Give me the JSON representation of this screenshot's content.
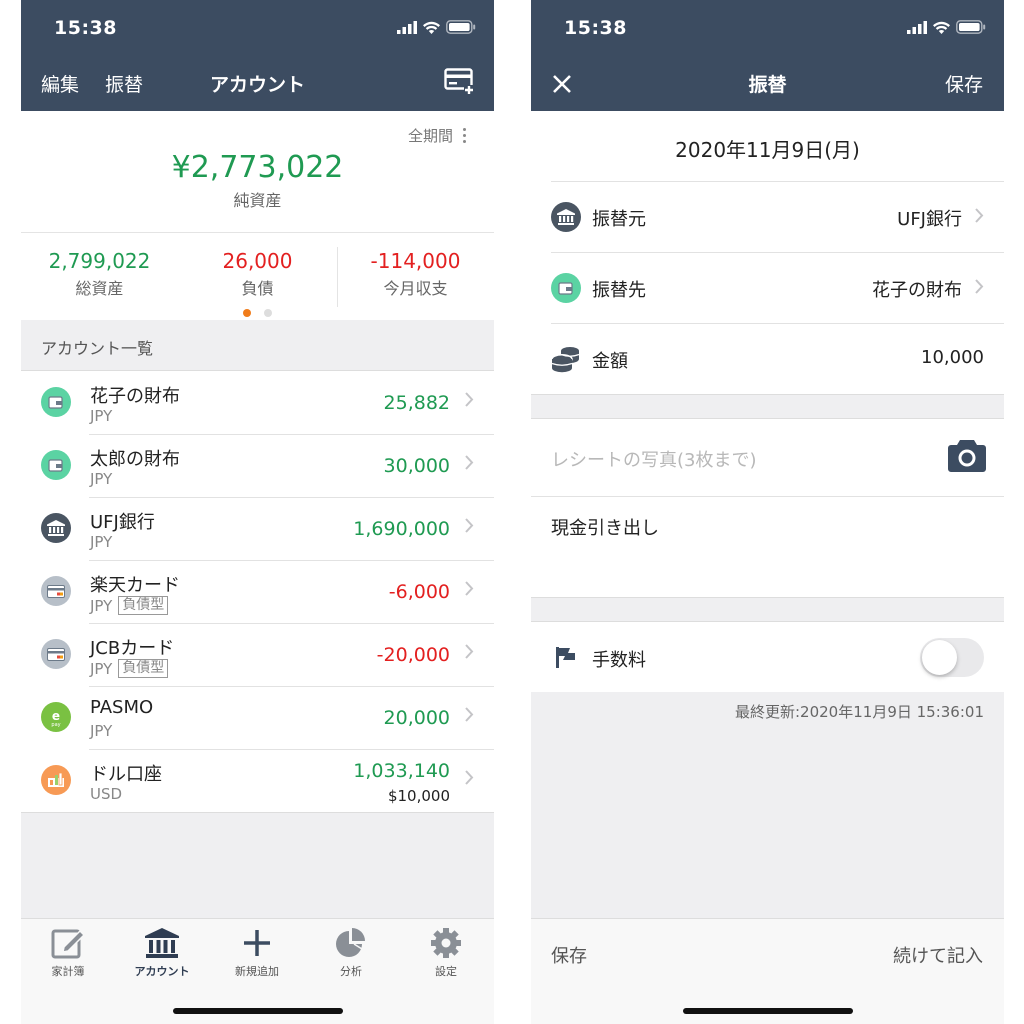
{
  "left": {
    "status": {
      "time": "15:38"
    },
    "nav": {
      "edit": "編集",
      "transfer": "振替",
      "title": "アカウント",
      "add_icon": "card-add-icon"
    },
    "summary": {
      "period": "全期間",
      "net_worth": "¥2,773,022",
      "net_worth_label": "純資産",
      "stats": [
        {
          "value": "2,799,022",
          "label": "総資産",
          "color": "#1f9a52"
        },
        {
          "value": "26,000",
          "label": "負債",
          "color": "#e32020"
        },
        {
          "value": "-114,000",
          "label": "今月収支",
          "color": "#e32020"
        }
      ],
      "page_index": 1,
      "page_count": 2
    },
    "section_title": "アカウント一覧",
    "accounts": [
      {
        "name": "花子の財布",
        "currency": "JPY",
        "amount": "25,882",
        "color": "green",
        "icon": "wallet-icon",
        "icon_bg": "#5bd3a3"
      },
      {
        "name": "太郎の財布",
        "currency": "JPY",
        "amount": "30,000",
        "color": "green",
        "icon": "wallet-icon",
        "icon_bg": "#5bd3a3"
      },
      {
        "name": "UFJ銀行",
        "currency": "JPY",
        "amount": "1,690,000",
        "color": "green",
        "icon": "bank-icon",
        "icon_bg": "#4a5562"
      },
      {
        "name": "楽天カード",
        "currency": "JPY",
        "tag": "負債型",
        "amount": "-6,000",
        "color": "red",
        "icon": "credit-card-icon",
        "icon_bg": "#b7bfc8"
      },
      {
        "name": "JCBカード",
        "currency": "JPY",
        "tag": "負債型",
        "amount": "-20,000",
        "color": "red",
        "icon": "credit-card-icon",
        "icon_bg": "#b7bfc8"
      },
      {
        "name": "PASMO",
        "currency": "JPY",
        "amount": "20,000",
        "color": "green",
        "icon": "e-money-icon",
        "icon_bg": "#7ac142"
      },
      {
        "name": "ドル口座",
        "currency": "USD",
        "amount": "1,033,140",
        "sub_amount": "$10,000",
        "color": "green",
        "icon": "foreign-account-icon",
        "icon_bg": "#f79a55"
      }
    ],
    "tabs": [
      {
        "label": "家計簿",
        "icon": "pencil-square-icon"
      },
      {
        "label": "アカウント",
        "icon": "bank-icon",
        "active": true
      },
      {
        "label": "新規追加",
        "icon": "plus-icon"
      },
      {
        "label": "分析",
        "icon": "pie-chart-icon"
      },
      {
        "label": "設定",
        "icon": "gear-icon"
      }
    ]
  },
  "right": {
    "status": {
      "time": "15:38"
    },
    "nav": {
      "close_icon": "close-icon",
      "title": "振替",
      "save": "保存"
    },
    "date": "2020年11月9日(月)",
    "rows": {
      "from": {
        "label": "振替元",
        "value": "UFJ銀行",
        "icon": "bank-icon"
      },
      "to": {
        "label": "振替先",
        "value": "花子の財布",
        "icon": "wallet-icon"
      },
      "amount": {
        "label": "金額",
        "value": "10,000",
        "icon": "coins-icon"
      }
    },
    "receipt_placeholder": "レシートの写真(3枚まで)",
    "memo": "現金引き出し",
    "fee": {
      "label": "手数料",
      "enabled": false
    },
    "last_updated": "最終更新:2020年11月9日 15:36:01",
    "bottom": {
      "save": "保存",
      "continue": "続けて記入"
    }
  },
  "colors": {
    "header": "#3c4c61",
    "positive": "#1f9a52",
    "negative": "#e32020",
    "dot_active": "#f07c1b",
    "dot_inactive": "#dddddd"
  }
}
